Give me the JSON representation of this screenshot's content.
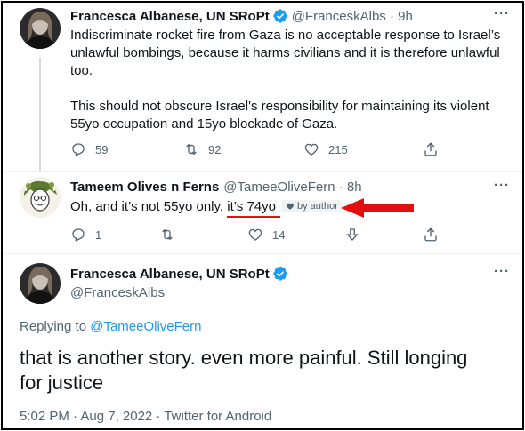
{
  "tweet1": {
    "name": "Francesca Albanese, UN SRoPt",
    "handle": "@FranceskAlbs · 9h",
    "line1": "Indiscriminate rocket fire from Gaza is no acceptable response to Israel’s",
    "line2": "unlawful bombings, because it harms civilians and it is therefore unlawful",
    "line3": "too.",
    "line4": "This should not obscure Israel's responsibility for maintaining its violent",
    "line5": "55yo occupation and 15yo blockade of Gaza.",
    "replies": "59",
    "retweets": "92",
    "likes": "215",
    "more": "···"
  },
  "tweet2": {
    "name": "Tameem Olives n Ferns",
    "handle": "@TameeOliveFern · 8h",
    "text_start": "Oh, and it’s not 55yo only, ",
    "text_highlight": "it’s 74yo",
    "badge": "by author",
    "replies": "1",
    "retweets": "",
    "likes": "14",
    "more": "···"
  },
  "tweet3": {
    "name": "Francesca Albanese, UN SRoPt",
    "handle": "@FranceskAlbs",
    "replying_prefix": "Replying to ",
    "replying_to": "@TameeOliveFern",
    "line1": "that is another story. even more painful. Still longing",
    "line2": "for justice",
    "meta": "5:02 PM · Aug 7, 2022 · Twitter for Android",
    "more": "···"
  },
  "colors": {
    "accent": "#1d9bf0",
    "annotation": "#e01010",
    "muted": "#536471"
  }
}
